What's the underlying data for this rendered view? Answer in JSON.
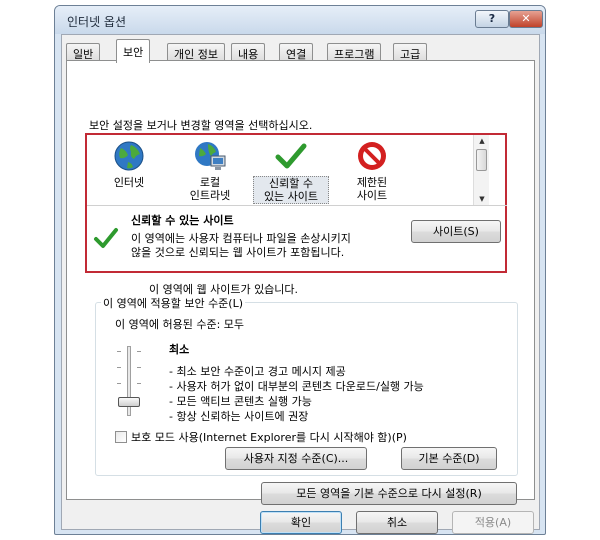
{
  "window": {
    "title": "인터넷 옵션",
    "help_label": "?",
    "close_label": "✕"
  },
  "tabs": [
    {
      "label": "일반"
    },
    {
      "label": "보안"
    },
    {
      "label": "개인 정보"
    },
    {
      "label": "내용"
    },
    {
      "label": "연결"
    },
    {
      "label": "프로그램"
    },
    {
      "label": "고급"
    }
  ],
  "security": {
    "prompt": "보안 설정을 보거나 변경할 영역을 선택하십시오.",
    "zones": [
      {
        "label": "인터넷",
        "icon": "globe-icon"
      },
      {
        "label": "로컬\n인트라넷",
        "icon": "intranet-icon"
      },
      {
        "label": "신뢰할 수\n있는 사이트",
        "icon": "checkmark-icon"
      },
      {
        "label": "제한된\n사이트",
        "icon": "restricted-icon"
      }
    ],
    "selected_zone": {
      "name": "신뢰할 수 있는 사이트",
      "description": "이 영역에는 사용자 컴퓨터나 파일을 손상시키지 않을 것으로 신뢰되는 웹 사이트가 포함됩니다.",
      "sites_button": "사이트(S)"
    },
    "zone_message": "이 영역에 웹 사이트가 있습니다.",
    "level_group": {
      "legend": "이 영역에 적용할 보안 수준(L)",
      "allowed": "이 영역에 허용된 수준: 모두",
      "level_name": "최소",
      "level_value": 0,
      "level_details": [
        "- 최소 보안 수준이고 경고 메시지 제공",
        "- 사용자 허가 없이 대부분의 콘텐츠 다운로드/실행 가능",
        "- 모든 액티브 콘텐츠 실행 가능",
        "- 항상 신뢰하는 사이트에 권장"
      ],
      "protected_mode_label": "보호 모드 사용(Internet Explorer를 다시 시작해야 함)(P)",
      "protected_mode_checked": false,
      "custom_level_button": "사용자 지정 수준(C)...",
      "default_level_button": "기본 수준(D)"
    },
    "reset_all_button": "모든 영역을 기본 수준으로 다시 설정(R)"
  },
  "footer": {
    "ok": "확인",
    "cancel": "취소",
    "apply": "적용(A)"
  },
  "colors": {
    "selection_border": "#c22a35",
    "check_green": "#2e9a2e",
    "restricted_red": "#d32020"
  }
}
